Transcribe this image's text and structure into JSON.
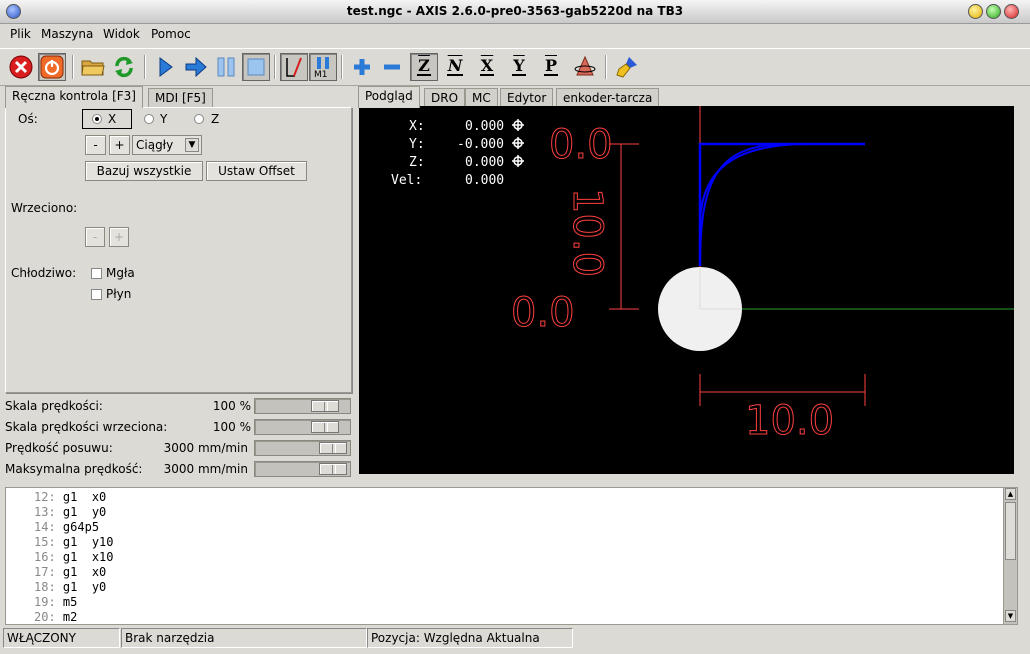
{
  "window": {
    "title": "test.ngc - AXIS 2.6.0-pre0-3563-gab5220d na TB3"
  },
  "menu": [
    "Plik",
    "Maszyna",
    "Widok",
    "Pomoc"
  ],
  "left_tabs": [
    "Ręczna kontrola [F3]",
    "MDI [F5]"
  ],
  "manual": {
    "axis_label": "Oś:",
    "axes": [
      "X",
      "Y",
      "Z"
    ],
    "selected_axis": "X",
    "minus": "-",
    "plus": "+",
    "jog_mode": "Ciągły",
    "home_all": "Bazuj wszystkie",
    "touch_off": "Ustaw Offset",
    "spindle_label": "Wrzeciono:",
    "spindle_minus": "-",
    "spindle_plus": "+",
    "coolant_label": "Chłodziwo:",
    "mist": "Mgła",
    "flood": "Płyn"
  },
  "overrides": [
    {
      "label": "Skala prędkości:",
      "value": "100 %",
      "level": 0.88
    },
    {
      "label": "Skala prędkości wrzeciona:",
      "value": "100 %",
      "level": 0.88
    },
    {
      "label": "Prędkość posuwu:",
      "value": "3000 mm/min",
      "level": 1.0
    },
    {
      "label": "Maksymalna prędkość:",
      "value": "3000 mm/min",
      "level": 1.0
    }
  ],
  "right_tabs": [
    "Podgląd",
    "DRO",
    "MC",
    "Edytor",
    "enkoder-tarcza"
  ],
  "dro": {
    "x_label": "X:",
    "x": "0.000",
    "y_label": "Y:",
    "y": "-0.000",
    "z_label": "Z:",
    "z": "0.000",
    "vel_label": "Vel:",
    "vel": "0.000"
  },
  "preview": {
    "dim_left_top": "0.0",
    "dim_vertical": "10.0",
    "dim_left_bottom": "0.0",
    "dim_bottom": "10.0",
    "colors": {
      "path": "#0000ff",
      "dimension": "#ff4040",
      "x_axis": "#2ca02c",
      "tool": "#f0f0f0"
    }
  },
  "code": [
    {
      "n": "12:",
      "text": "g1  x0"
    },
    {
      "n": "13:",
      "text": "g1  y0"
    },
    {
      "n": "14:",
      "text": "g64p5"
    },
    {
      "n": "15:",
      "text": "g1  y10"
    },
    {
      "n": "16:",
      "text": "g1  x10"
    },
    {
      "n": "17:",
      "text": "g1  x0"
    },
    {
      "n": "18:",
      "text": "g1  y0"
    },
    {
      "n": "19:",
      "text": "m5"
    },
    {
      "n": "20:",
      "text": "m2"
    }
  ],
  "status": {
    "machine": "WŁĄCZONY",
    "tool": "Brak narzędzia",
    "position": "Pozycja: Względna Aktualna"
  }
}
